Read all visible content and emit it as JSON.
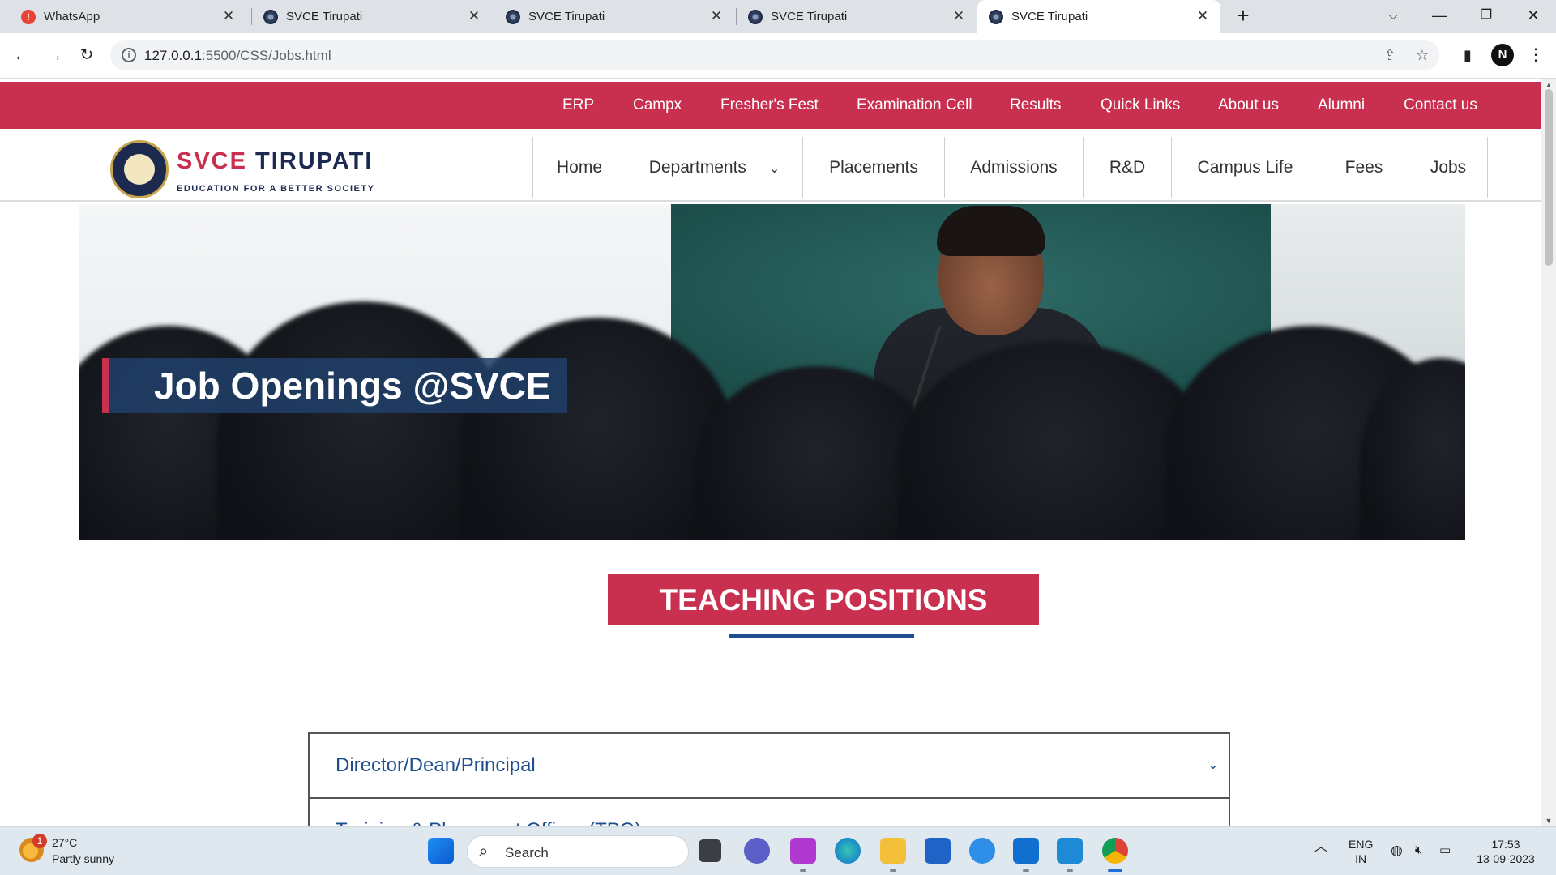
{
  "browser": {
    "tabs": [
      {
        "title": "WhatsApp",
        "favicon": "whatsapp-alert-icon",
        "active": false
      },
      {
        "title": "SVCE Tirupati",
        "favicon": "svce-logo-icon",
        "active": false
      },
      {
        "title": "SVCE Tirupati",
        "favicon": "svce-logo-icon",
        "active": false
      },
      {
        "title": "SVCE Tirupati",
        "favicon": "svce-logo-icon",
        "active": false
      },
      {
        "title": "SVCE Tirupati",
        "favicon": "svce-logo-icon",
        "active": true
      }
    ],
    "url_host": "127.0.0.1",
    "url_path": ":5500/CSS/Jobs.html",
    "profile_initial": "N"
  },
  "site": {
    "colors": {
      "brand_red": "#c9304f",
      "brand_navy": "#1b2a4e",
      "link_blue": "#1f4e8c"
    },
    "top_links": [
      "ERP",
      "Campx",
      "Fresher's Fest",
      "Examination Cell",
      "Results",
      "Quick Links",
      "About us",
      "Alumni",
      "Contact us"
    ],
    "logo": {
      "name_part1": "SVCE",
      "name_part2": "TIRUPATI",
      "tagline": "EDUCATION FOR A BETTER SOCIETY"
    },
    "nav": [
      "Home",
      "Departments",
      "Placements",
      "Admissions",
      "R&D",
      "Campus Life",
      "Fees",
      "Jobs"
    ],
    "hero_title": "Job Openings @SVCE",
    "section_title": "TEACHING POSITIONS",
    "accordion": [
      {
        "title": "Director/Dean/Principal",
        "expanded": false
      },
      {
        "title": "Training & Placement Officer (TPO)",
        "expanded": false
      }
    ]
  },
  "taskbar": {
    "weather": {
      "temp": "27°C",
      "desc": "Partly sunny",
      "badge": "1"
    },
    "search_placeholder": "Search",
    "lang_top": "ENG",
    "lang_bottom": "IN",
    "time": "17:53",
    "date": "13-09-2023"
  }
}
